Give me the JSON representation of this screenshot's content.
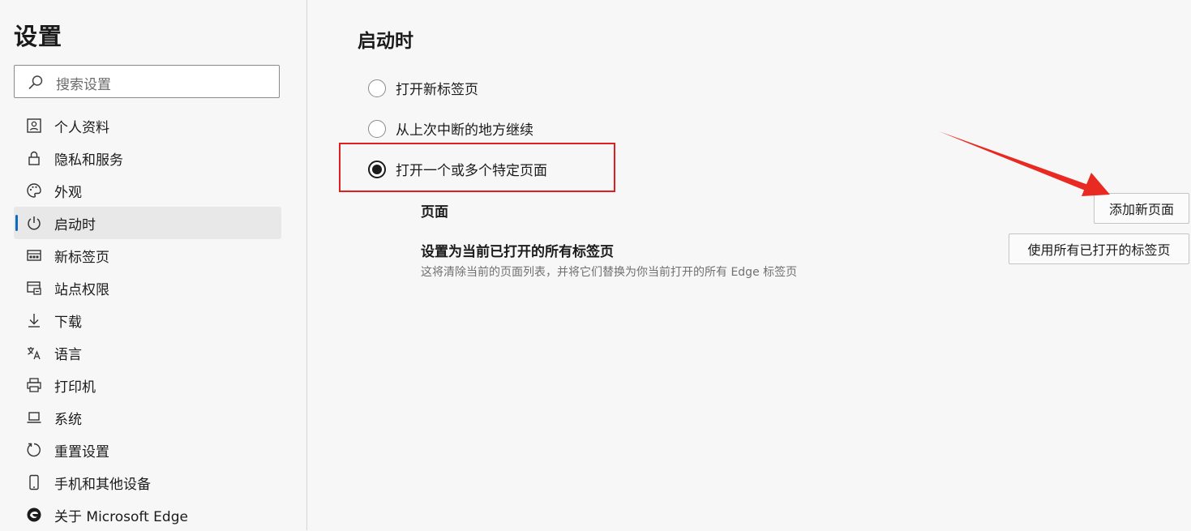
{
  "sidebar": {
    "title": "设置",
    "search_placeholder": "搜索设置",
    "items": [
      {
        "label": "个人资料",
        "icon": "profile-icon"
      },
      {
        "label": "隐私和服务",
        "icon": "lock-icon"
      },
      {
        "label": "外观",
        "icon": "palette-icon"
      },
      {
        "label": "启动时",
        "icon": "power-icon",
        "active": true
      },
      {
        "label": "新标签页",
        "icon": "new-tab-icon"
      },
      {
        "label": "站点权限",
        "icon": "site-permissions-icon"
      },
      {
        "label": "下载",
        "icon": "download-icon"
      },
      {
        "label": "语言",
        "icon": "language-icon"
      },
      {
        "label": "打印机",
        "icon": "printer-icon"
      },
      {
        "label": "系统",
        "icon": "laptop-icon"
      },
      {
        "label": "重置设置",
        "icon": "reset-icon"
      },
      {
        "label": "手机和其他设备",
        "icon": "phone-icon"
      },
      {
        "label": "关于 Microsoft Edge",
        "icon": "edge-logo-icon"
      }
    ]
  },
  "main": {
    "title": "启动时",
    "options": [
      {
        "label": "打开新标签页",
        "checked": false
      },
      {
        "label": "从上次中断的地方继续",
        "checked": false
      },
      {
        "label": "打开一个或多个特定页面",
        "checked": true
      }
    ],
    "pages_label": "页面",
    "add_button": "添加新页面",
    "use_all_title": "设置为当前已打开的所有标签页",
    "use_all_desc": "这将清除当前的页面列表，并将它们替换为你当前打开的所有 Edge 标签页",
    "use_all_button": "使用所有已打开的标签页"
  },
  "colors": {
    "accent": "#0f6cbd",
    "annotation": "#e02020"
  }
}
